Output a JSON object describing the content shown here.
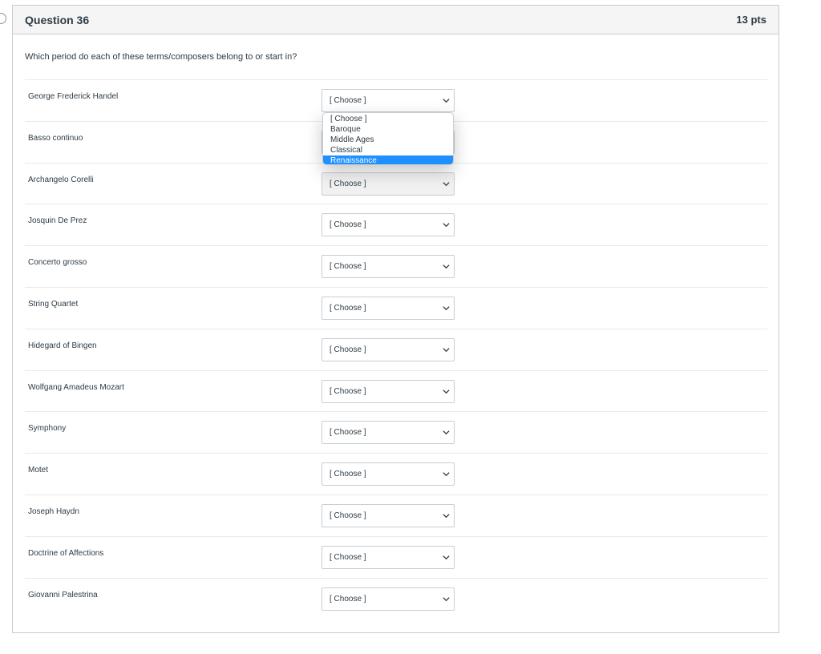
{
  "question": {
    "title": "Question 36",
    "points": "13 pts",
    "prompt": "Which period do each of these terms/composers belong to or start in?"
  },
  "rows": [
    {
      "label": "George Frederick Handel",
      "selected": "[ Choose ]"
    },
    {
      "label": "Basso continuo",
      "selected": "[ Choose ]"
    },
    {
      "label": "Archangelo Corelli",
      "selected": "[ Choose ]"
    },
    {
      "label": "Josquin De Prez",
      "selected": "[ Choose ]"
    },
    {
      "label": "Concerto grosso",
      "selected": "[ Choose ]"
    },
    {
      "label": "String Quartet",
      "selected": "[ Choose ]"
    },
    {
      "label": "Hidegard of Bingen",
      "selected": "[ Choose ]"
    },
    {
      "label": "Wolfgang Amadeus Mozart",
      "selected": "[ Choose ]"
    },
    {
      "label": "Symphony",
      "selected": "[ Choose ]"
    },
    {
      "label": "Motet",
      "selected": "[ Choose ]"
    },
    {
      "label": "Joseph Haydn",
      "selected": "[ Choose ]"
    },
    {
      "label": "Doctrine of Affections",
      "selected": "[ Choose ]"
    },
    {
      "label": "Giovanni Palestrina",
      "selected": "[ Choose ]"
    }
  ],
  "dropdown": {
    "options": [
      "[ Choose ]",
      "Baroque",
      "Middle Ages",
      "Classical",
      "Renaissance"
    ],
    "highlighted": "Renaissance"
  },
  "colors": {
    "highlight": "#1e90ff",
    "text": "#2d3b45",
    "border": "#c7cdd1",
    "header_bg": "#f5f5f5"
  },
  "icons": {
    "select_arrow": "chevron-down-icon",
    "flag": "question-flag-icon"
  }
}
